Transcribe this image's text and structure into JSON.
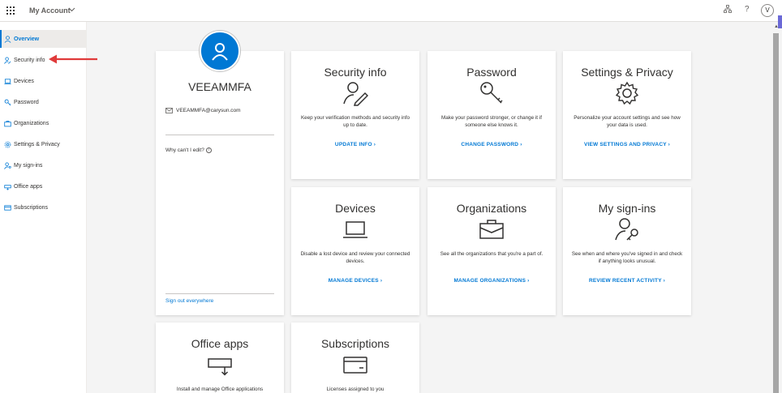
{
  "topbar": {
    "app_title": "My Account",
    "user_initial": "V",
    "help_label": "?"
  },
  "sidebar": {
    "items": [
      {
        "label": "Overview",
        "icon": "person-icon",
        "active": true
      },
      {
        "label": "Security info",
        "icon": "person-key-icon",
        "active": false
      },
      {
        "label": "Devices",
        "icon": "laptop-icon",
        "active": false
      },
      {
        "label": "Password",
        "icon": "key-icon",
        "active": false
      },
      {
        "label": "Organizations",
        "icon": "briefcase-icon",
        "active": false
      },
      {
        "label": "Settings & Privacy",
        "icon": "gear-icon",
        "active": false
      },
      {
        "label": "My sign-ins",
        "icon": "person-key-icon",
        "active": false
      },
      {
        "label": "Office apps",
        "icon": "apps-icon",
        "active": false
      },
      {
        "label": "Subscriptions",
        "icon": "card-icon",
        "active": false
      }
    ]
  },
  "profile": {
    "name": "VEEAMMFA",
    "email": "VEEAMMFA@carysun.com",
    "why_cant_edit": "Why can't I edit?",
    "sign_out": "Sign out everywhere"
  },
  "cards": {
    "security": {
      "title": "Security info",
      "desc": "Keep your verification methods and security info up to date.",
      "link": "UPDATE INFO ›"
    },
    "password": {
      "title": "Password",
      "desc": "Make your password stronger, or change it if someone else knows it.",
      "link": "CHANGE PASSWORD ›"
    },
    "settings": {
      "title": "Settings & Privacy",
      "desc": "Personalize your account settings and see how your data is used.",
      "link": "VIEW SETTINGS AND PRIVACY ›"
    },
    "devices": {
      "title": "Devices",
      "desc": "Disable a lost device and review your connected devices.",
      "link": "MANAGE DEVICES ›"
    },
    "organizations": {
      "title": "Organizations",
      "desc": "See all the organizations that you're a part of.",
      "link": "MANAGE ORGANIZATIONS ›"
    },
    "signins": {
      "title": "My sign-ins",
      "desc": "See when and where you've signed in and check if anything looks unusual.",
      "link": "REVIEW RECENT ACTIVITY ›"
    },
    "office": {
      "title": "Office apps",
      "desc": "Install and manage Office applications"
    },
    "subscriptions": {
      "title": "Subscriptions",
      "desc": "Licenses assigned to you"
    }
  },
  "colors": {
    "accent": "#0078d4",
    "annotation_arrow": "#e03a3a"
  }
}
